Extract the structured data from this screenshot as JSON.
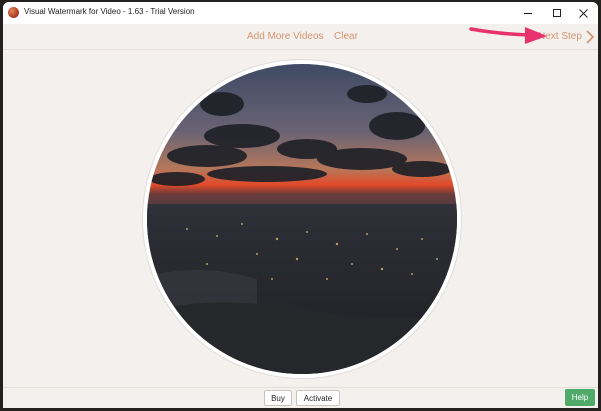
{
  "window": {
    "title": "Visual Watermark for Video - 1.63 - Trial Version"
  },
  "toolbar": {
    "add_more_videos": "Add More Videos",
    "clear": "Clear",
    "next_step": "Next Step"
  },
  "bottom": {
    "buy": "Buy",
    "activate": "Activate",
    "help": "Help"
  },
  "colors": {
    "link": "#d3956e",
    "help_button": "#4faa6a",
    "annotation_arrow": "#e8326e",
    "background": "#f4f0ee"
  },
  "icons": {
    "app": "app-icon",
    "minimize": "minimize-icon",
    "maximize": "maximize-icon",
    "close": "close-icon",
    "next": "chevron-right-icon",
    "annotation": "pink-arrow-icon"
  }
}
